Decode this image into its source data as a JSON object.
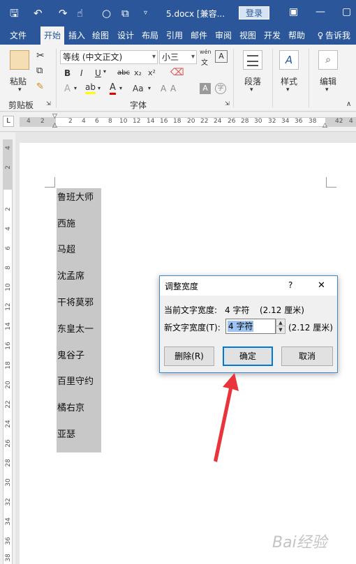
{
  "titlebar": {
    "filename": "5.docx [兼容...",
    "login_label": "登录"
  },
  "tabs": [
    "文件",
    "开始",
    "插入",
    "绘图",
    "设计",
    "布局",
    "引用",
    "邮件",
    "审阅",
    "视图",
    "开发",
    "帮助",
    "告诉我"
  ],
  "active_tab": "开始",
  "ribbon": {
    "clipboard": {
      "paste_label": "粘贴",
      "group_label": "剪贴板"
    },
    "font": {
      "font_name": "等线 (中文正文)",
      "font_size": "小三",
      "phonetic_label": "wén",
      "group_label": "字体",
      "bold": "B",
      "italic": "I",
      "underline": "U",
      "strike": "abc",
      "sub": "x₂",
      "sup": "x²",
      "color_a": "A",
      "change_case": "Aa",
      "circle_char": "字"
    },
    "paragraph_label": "段落",
    "styles_label": "样式",
    "editing_label": "编辑"
  },
  "ruler": {
    "tab_selector": "L",
    "h_numbers": [
      "4",
      "2",
      "2",
      "4",
      "6",
      "8",
      "10",
      "12",
      "14",
      "16",
      "18",
      "20",
      "22",
      "24",
      "26",
      "28",
      "30",
      "32",
      "34",
      "36",
      "38",
      "42",
      "4"
    ],
    "v_numbers": [
      "4",
      "2",
      "2",
      "4",
      "6",
      "8",
      "10",
      "12",
      "14",
      "16",
      "18",
      "20",
      "22",
      "24",
      "26",
      "28",
      "30",
      "32",
      "34",
      "36",
      "38"
    ]
  },
  "document": {
    "names": [
      "鲁班大师",
      "西施",
      "马超",
      "沈孟席",
      "干将莫邪",
      "东皇太一",
      "鬼谷子",
      "百里守约",
      "橘右京",
      "亚瑟"
    ]
  },
  "dialog": {
    "title": "调整宽度",
    "help": "?",
    "close": "✕",
    "current_label": "当前文字宽度:",
    "current_value": "4 字符",
    "current_cm": "(2.12 厘米)",
    "new_label": "新文字宽度(T):",
    "new_value": "4 字符",
    "new_cm": "(2.12 厘米)",
    "delete_label": "删除(R)",
    "ok_label": "确定",
    "cancel_label": "取消"
  },
  "watermark": "Bai经验",
  "colors": {
    "accent": "#2b579a",
    "dialog_border": "#3f8bd0",
    "highlight": "#c8c8c8",
    "arrow": "#e8343a"
  }
}
